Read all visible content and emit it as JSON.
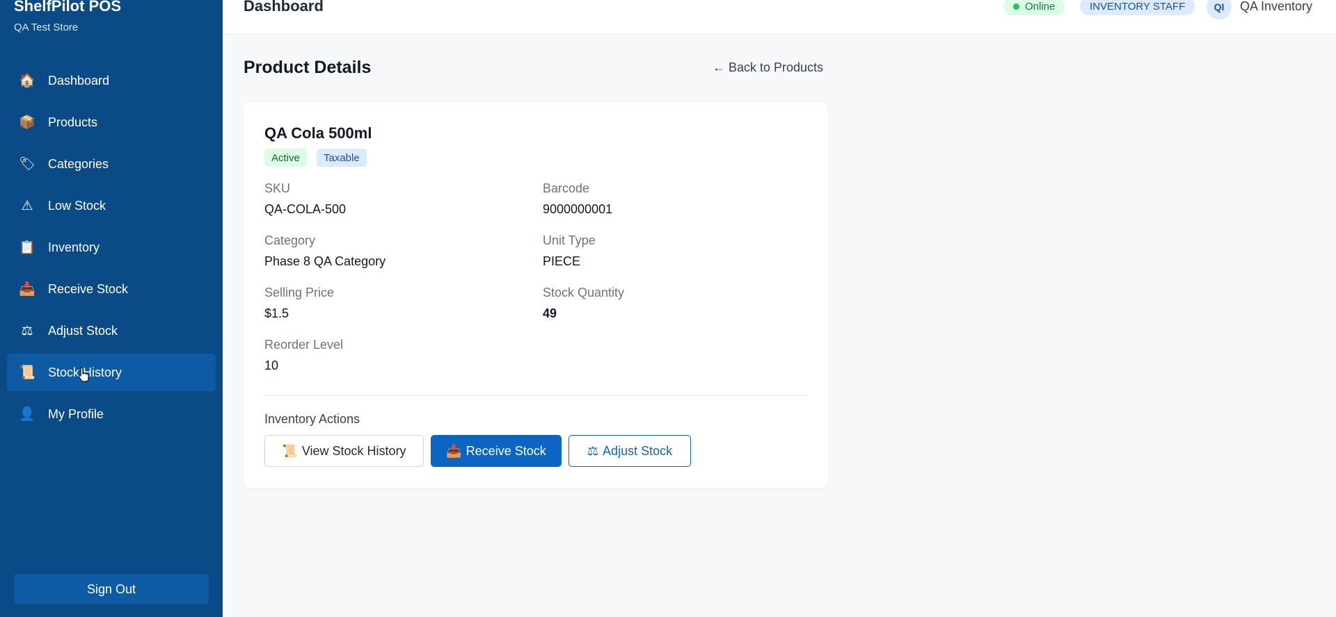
{
  "app": {
    "brand": "ShelfPilot POS",
    "store": "QA Test Store"
  },
  "sidebar": {
    "items": [
      {
        "label": "Dashboard",
        "icon": "house-icon"
      },
      {
        "label": "Products",
        "icon": "box-icon"
      },
      {
        "label": "Categories",
        "icon": "tag-icon"
      },
      {
        "label": "Low Stock",
        "icon": "warning-icon"
      },
      {
        "label": "Inventory",
        "icon": "clipboard-icon"
      },
      {
        "label": "Receive Stock",
        "icon": "inbox-tray-icon"
      },
      {
        "label": "Adjust Stock",
        "icon": "scale-icon"
      },
      {
        "label": "Stock History",
        "icon": "scroll-icon",
        "active": true
      },
      {
        "label": "My Profile",
        "icon": "user-icon"
      }
    ],
    "sign_out": "Sign Out"
  },
  "header": {
    "title": "Dashboard",
    "status": "Online",
    "role": "INVENTORY STAFF",
    "avatar_initials": "QI",
    "user_name": "QA Inventory"
  },
  "main": {
    "page_title": "Product Details",
    "back_link": "← Back to Products",
    "product": {
      "name": "QA Cola 500ml",
      "tags": [
        "Active",
        "Taxable"
      ],
      "fields": {
        "sku": {
          "label": "SKU",
          "value": "QA-COLA-500"
        },
        "barcode": {
          "label": "Barcode",
          "value": "9000000001"
        },
        "category": {
          "label": "Category",
          "value": "Phase 8 QA Category"
        },
        "unit_type": {
          "label": "Unit Type",
          "value": "PIECE"
        },
        "selling_price": {
          "label": "Selling Price",
          "value": "$1.5"
        },
        "stock_quantity": {
          "label": "Stock Quantity",
          "value": "49"
        },
        "reorder_level": {
          "label": "Reorder Level",
          "value": "10"
        }
      }
    },
    "actions": {
      "title": "Inventory Actions",
      "view_history": "View Stock History",
      "receive_stock": "Receive Stock",
      "adjust_stock": "Adjust Stock"
    }
  },
  "colors": {
    "sidebar_bg": "#0a4a86",
    "sidebar_active": "#0e5aa3",
    "primary": "#0b66c3",
    "online_green": "#22c55e"
  }
}
